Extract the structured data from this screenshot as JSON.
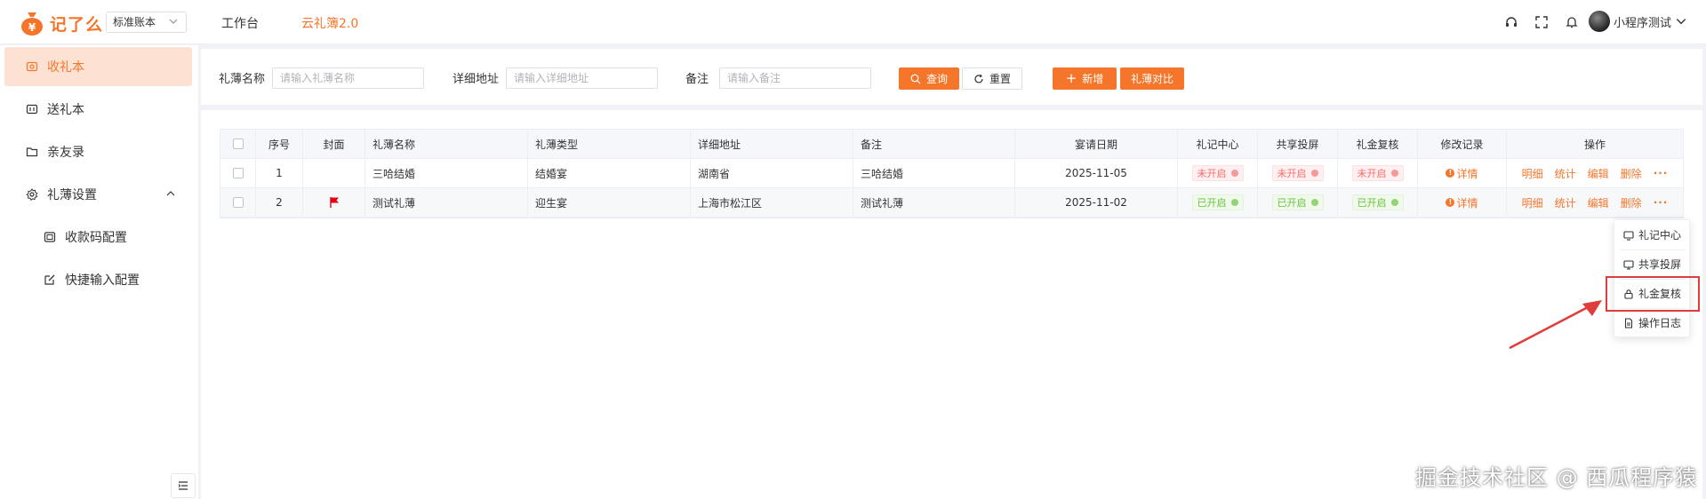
{
  "header": {
    "logo_text": "记了么",
    "account_select": "标准账本",
    "nav": [
      "工作台",
      "云礼簿2.0"
    ],
    "user_name": "小程序测试",
    "accent": "#f5762a"
  },
  "sidebar": {
    "items": [
      {
        "label": "收礼本",
        "icon": "gift-book-icon"
      },
      {
        "label": "送礼本",
        "icon": "send-book-icon"
      },
      {
        "label": "亲友录",
        "icon": "folder-icon"
      },
      {
        "label": "礼薄设置",
        "icon": "gear-icon"
      },
      {
        "label": "收款码配置",
        "icon": "qrcode-icon"
      },
      {
        "label": "快捷输入配置",
        "icon": "edit-icon"
      }
    ]
  },
  "filter": {
    "name_label": "礼薄名称",
    "name_placeholder": "请输入礼薄名称",
    "address_label": "详细地址",
    "address_placeholder": "请输入详细地址",
    "remark_label": "备注",
    "remark_placeholder": "请输入备注",
    "search_btn": "查询",
    "reset_btn": "重置",
    "add_btn": "新增",
    "compare_btn": "礼薄对比"
  },
  "table": {
    "headers": [
      "序号",
      "封面",
      "礼薄名称",
      "礼薄类型",
      "详细地址",
      "备注",
      "宴请日期",
      "礼记中心",
      "共享投屏",
      "礼金复核",
      "修改记录",
      "操作"
    ],
    "rows": [
      {
        "index": "1",
        "name": "三哈结婚",
        "type": "结婚宴",
        "address": "湖南省",
        "remark": "三哈结婚",
        "date": "2025-11-05",
        "center": "未开启",
        "share": "未开启",
        "review": "未开启",
        "record": "详情"
      },
      {
        "index": "2",
        "name": "测试礼薄",
        "type": "迎生宴",
        "address": "上海市松江区",
        "remark": "测试礼薄",
        "date": "2025-11-02",
        "center": "已开启",
        "share": "已开启",
        "review": "已开启",
        "record": "详情"
      }
    ],
    "actions": [
      "明细",
      "统计",
      "编辑",
      "删除"
    ]
  },
  "dropdown": {
    "items": [
      "礼记中心",
      "共享投屏",
      "礼金复核",
      "操作日志"
    ]
  },
  "watermark": "掘金技术社区 @ 西瓜程序猿"
}
